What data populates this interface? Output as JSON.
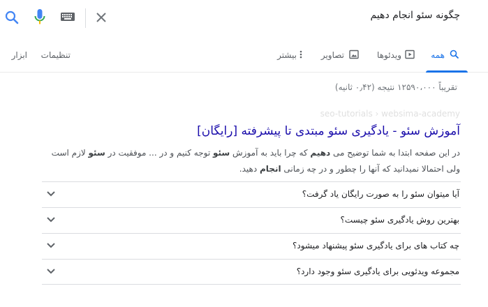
{
  "search": {
    "query": "چگونه سئو انجام دهیم"
  },
  "tabs": {
    "all": "همه",
    "videos": "ویدئوها",
    "images": "تصاویر",
    "more": "بیشتر",
    "settings": "تنظیمات",
    "tools": "ابزار"
  },
  "stats": "تقریباً ۱۲۵۹۰،۰۰۰ نتیجه (۰٫۴۲ ثانیه)",
  "result": {
    "breadcrumb": "seo-tutorials › websima-academy",
    "title": "آموزش سئو - یادگیری سئو مبتدی تا پیشرفته [رایگان]",
    "line1_a": "در این صفحه ابتدا به شما توضیح می ",
    "line1_b": "دهیم",
    "line1_c": " که چرا باید به آموزش ",
    "line1_d": "سئو",
    "line1_e": " توجه کنیم و در ... موفقیت در ",
    "line1_f": "سئو",
    "line1_g": " لازم است",
    "line2_a": "ولی احتمالا نمیدانید که آنها را چطور و در چه زمانی ",
    "line2_b": "انجام",
    "line2_c": " دهید."
  },
  "faq": [
    {
      "question": "آیا میتوان سئو را به صورت رایگان یاد گرفت؟"
    },
    {
      "question": "بهترین روش یادگیری سئو چیست؟"
    },
    {
      "question": "چه کتاب های برای یادگیری سئو پیشنهاد میشود؟"
    },
    {
      "question": "مجموعه ویدئویی برای یادگیری سئو وجود دارد؟"
    }
  ],
  "colors": {
    "link": "#1a0dab",
    "accent": "#1a73e8"
  }
}
